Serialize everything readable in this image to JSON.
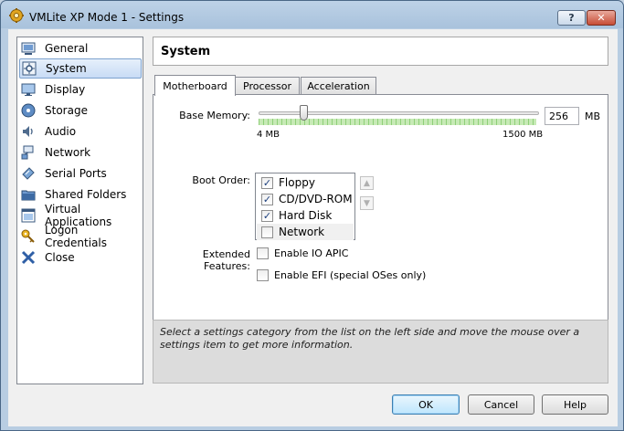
{
  "window": {
    "title": "VMLite XP Mode 1 - Settings",
    "help_glyph": "?",
    "close_glyph": "✕"
  },
  "sidebar": {
    "items": [
      {
        "label": "General",
        "icon": "general-icon"
      },
      {
        "label": "System",
        "icon": "system-icon",
        "selected": true
      },
      {
        "label": "Display",
        "icon": "display-icon"
      },
      {
        "label": "Storage",
        "icon": "storage-icon"
      },
      {
        "label": "Audio",
        "icon": "audio-icon"
      },
      {
        "label": "Network",
        "icon": "network-icon"
      },
      {
        "label": "Serial Ports",
        "icon": "serial-ports-icon"
      },
      {
        "label": "Shared Folders",
        "icon": "shared-folders-icon"
      },
      {
        "label": "Virtual Applications",
        "icon": "virtual-applications-icon"
      },
      {
        "label": "Logon Credentials",
        "icon": "key-icon"
      },
      {
        "label": "Close",
        "icon": "close-x-icon"
      }
    ]
  },
  "page": {
    "title": "System"
  },
  "tabs": [
    {
      "label": "Motherboard",
      "active": true
    },
    {
      "label": "Processor"
    },
    {
      "label": "Acceleration"
    }
  ],
  "motherboard": {
    "base_memory_label": "Base Memory:",
    "base_memory_value": "256",
    "base_memory_unit": "MB",
    "slider_min_label": "4 MB",
    "slider_max_label": "1500 MB",
    "slider_value_fraction": 0.168,
    "boot_order_label": "Boot Order:",
    "boot_items": [
      {
        "label": "Floppy",
        "checked": true
      },
      {
        "label": "CD/DVD-ROM",
        "checked": true
      },
      {
        "label": "Hard Disk",
        "checked": true
      },
      {
        "label": "Network",
        "checked": false
      }
    ],
    "extended_features_label": "Extended Features:",
    "features": [
      {
        "label": "Enable IO APIC",
        "checked": false
      },
      {
        "label": "Enable EFI (special OSes only)",
        "checked": false
      }
    ]
  },
  "info": {
    "text": "Select a settings category from the list on the left side and move the mouse over a settings item to get more information."
  },
  "buttons": {
    "ok": "OK",
    "cancel": "Cancel",
    "help": "Help"
  },
  "colors": {
    "selection": "#c8dcf5",
    "slider_ticks": "#8fcf79",
    "default_button": "#bee6fd"
  }
}
